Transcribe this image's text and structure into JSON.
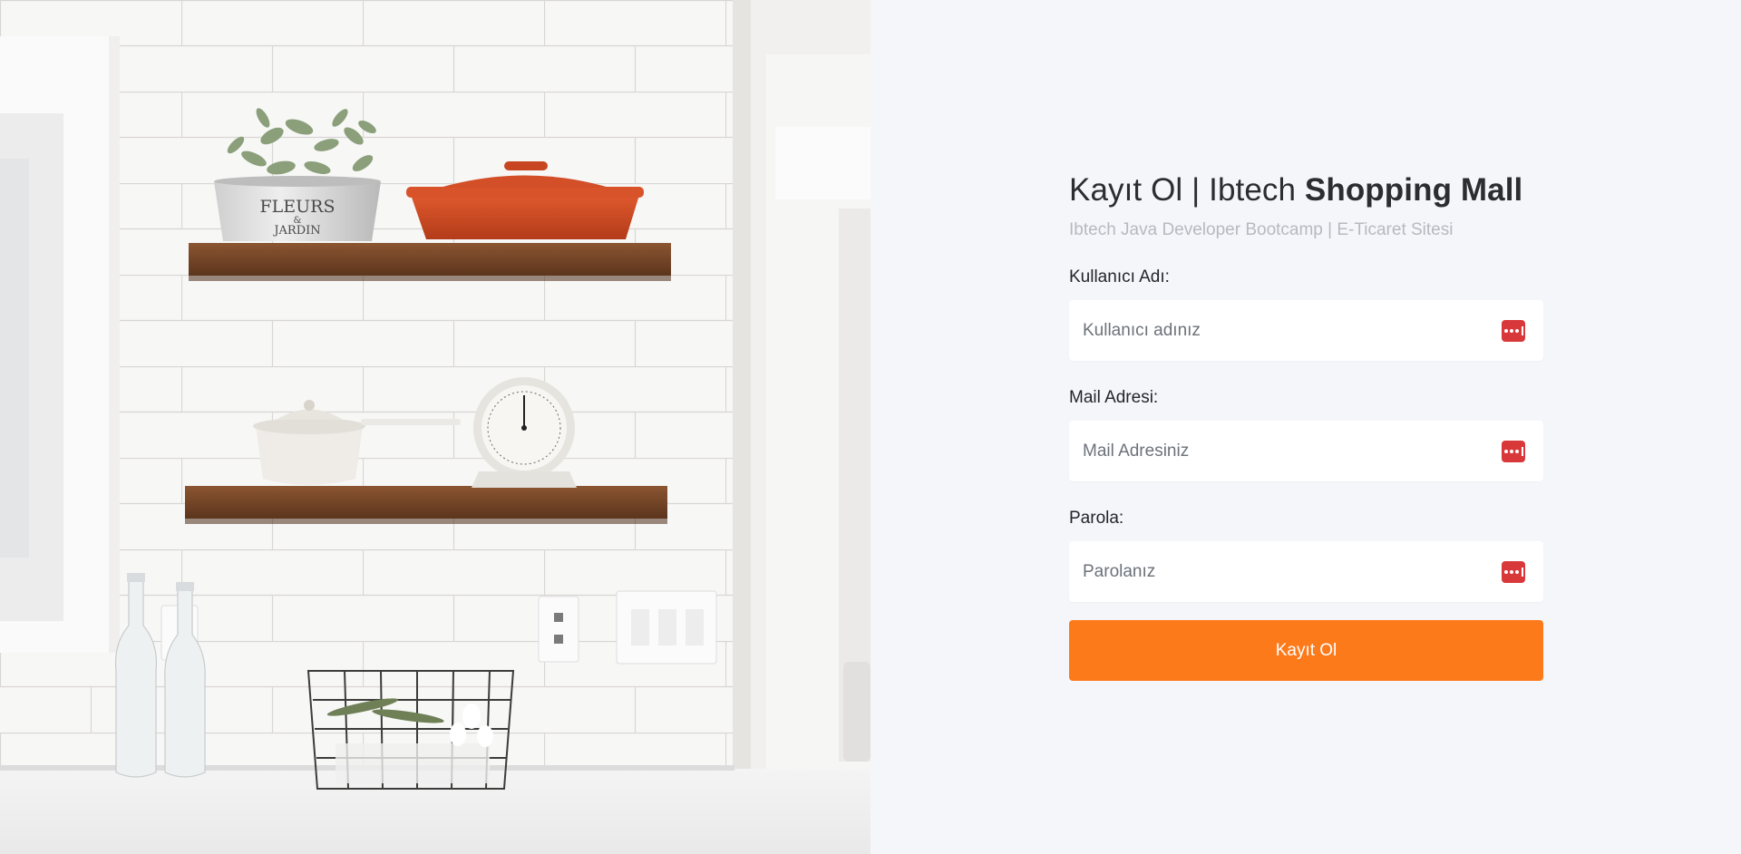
{
  "header": {
    "title_regular": "Kayıt Ol | Ibtech ",
    "title_bold": "Shopping Mall",
    "subtitle": "Ibtech Java Developer Bootcamp | E-Ticaret Sitesi"
  },
  "form": {
    "username": {
      "label": "Kullanıcı Adı:",
      "placeholder": "Kullanıcı adınız",
      "value": ""
    },
    "email": {
      "label": "Mail Adresi:",
      "placeholder": "Mail Adresiniz",
      "value": ""
    },
    "password": {
      "label": "Parola:",
      "placeholder": "Parolanız",
      "value": ""
    },
    "submit_label": "Kayıt Ol"
  },
  "icons": {
    "field_action_icon": "password-manager-icon"
  },
  "colors": {
    "accent": "#fd7a1b",
    "icon_red": "#d9383a",
    "background": "#f5f6fa",
    "title_text": "#2b2d31",
    "subtitle_text": "#b7b9bf"
  },
  "photo": {
    "pot_label_line1": "FLEURS",
    "pot_label_line2": "&",
    "pot_label_line3": "JARDIN"
  }
}
